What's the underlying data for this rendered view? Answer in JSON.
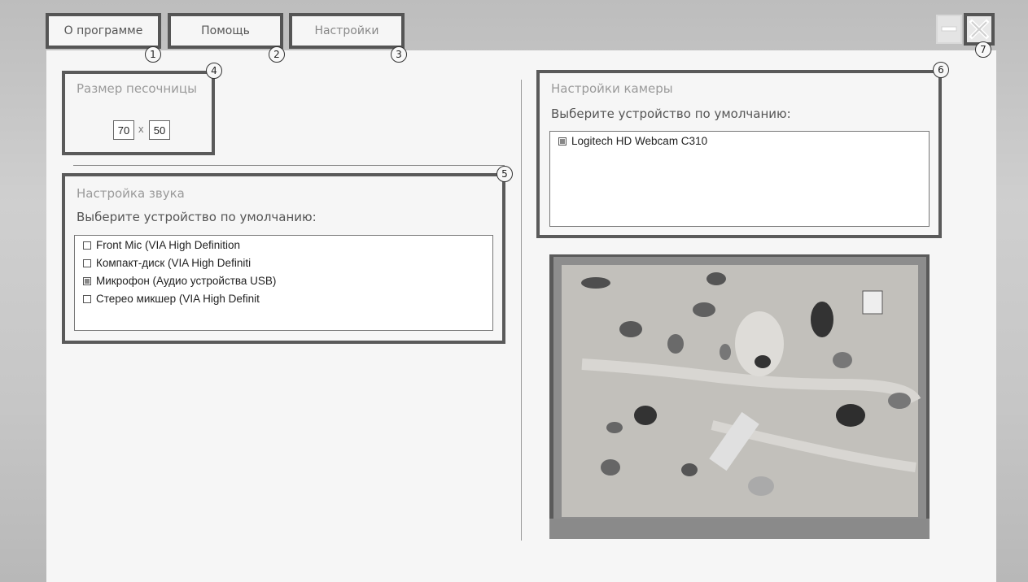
{
  "tabs": [
    {
      "label": "О программе",
      "badge": "1",
      "active": true
    },
    {
      "label": "Помощь",
      "badge": "2",
      "active": true
    },
    {
      "label": "Настройки",
      "badge": "3",
      "active": false
    }
  ],
  "window_controls": {
    "minimize_icon": "minimize-icon",
    "close_icon": "close-icon",
    "close_badge": "7"
  },
  "sandbox_size": {
    "title": "Размер песочницы",
    "badge": "4",
    "width": "70",
    "separator": "x",
    "height": "50"
  },
  "sound": {
    "title": "Настройка звука",
    "subtitle": "Выберите устройство по умолчанию:",
    "badge": "5",
    "devices": [
      {
        "label": "Front Mic (VIA High Definition",
        "checked": false
      },
      {
        "label": "Компакт-диск (VIA High Definiti",
        "checked": false
      },
      {
        "label": "Микрофон (Аудио устройства USB)",
        "checked": true
      },
      {
        "label": "Стерео микшер (VIA High Definit",
        "checked": false
      }
    ]
  },
  "camera": {
    "title": "Настройки камеры",
    "subtitle": "Выберите устройство по умолчанию:",
    "badge": "6",
    "devices": [
      {
        "label": "Logitech HD Webcam C310",
        "checked": true
      }
    ]
  },
  "preview": {
    "description_icon": "camera-preview-image"
  },
  "colors": {
    "background": "#c8c8c8",
    "panel": "#f6f6f6",
    "highlight_border": "#555555",
    "text_gray": "#9a9a9a",
    "text_dark": "#555555"
  }
}
